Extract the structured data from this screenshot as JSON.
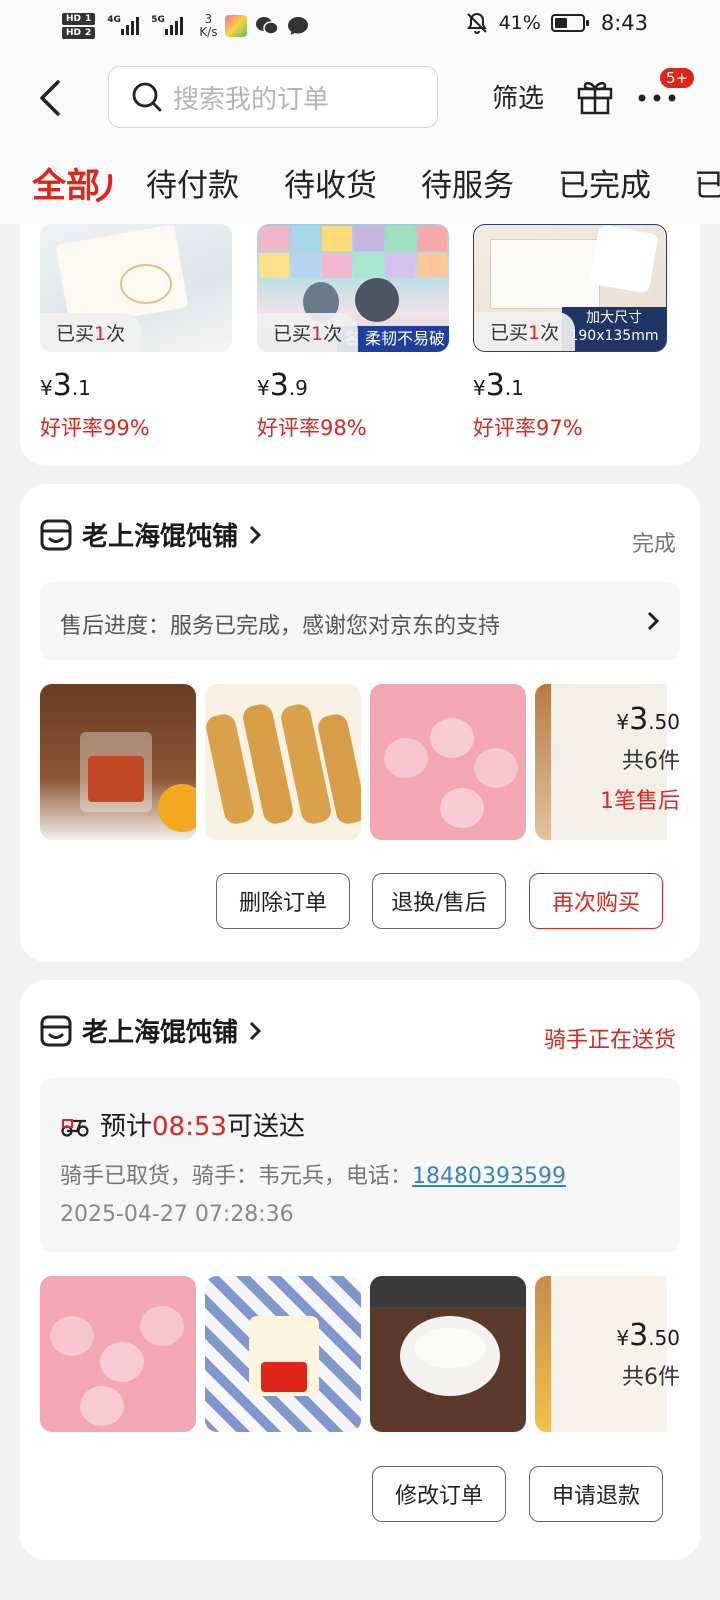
{
  "status_bar": {
    "hd1": "HD",
    "hd1_sub": "1",
    "hd2": "HD",
    "hd2_sub": "2",
    "net1": "4G",
    "net2": "5G",
    "speed_value": "3",
    "speed_unit": "K/s",
    "battery": "41%",
    "time": "8:43"
  },
  "header": {
    "search_placeholder": "搜索我的订单",
    "filter_label": "筛选",
    "notification_badge": "5+"
  },
  "tabs": [
    {
      "label": "全部",
      "active": true
    },
    {
      "label": "待付款"
    },
    {
      "label": "待收货"
    },
    {
      "label": "待服务"
    },
    {
      "label": "已完成"
    },
    {
      "label": "已"
    }
  ],
  "recommend": {
    "items": [
      {
        "bought_prefix": "已买",
        "bought_count": "1",
        "bought_suffix": "次",
        "price_symbol": "¥",
        "price_int": "3",
        "price_dec": ".1",
        "rating": "好评率99%"
      },
      {
        "bought_prefix": "已买",
        "bought_count": "1",
        "bought_suffix": "次",
        "price_symbol": "¥",
        "price_int": "3",
        "price_dec": ".9",
        "rating": "好评率98%",
        "banner": "名 柔韧不易破"
      },
      {
        "bought_prefix": "已买",
        "bought_count": "1",
        "bought_suffix": "次",
        "price_symbol": "¥",
        "price_int": "3",
        "price_dec": ".1",
        "rating": "好评率97%",
        "banner": "加大尺寸",
        "banner2": "190x135mm"
      }
    ]
  },
  "order1": {
    "shop_name": "老上海馄饨铺",
    "status": "完成",
    "progress": "售后进度：服务已完成，感谢您对京东的支持",
    "price_symbol": "¥",
    "price_int": "3",
    "price_dec": ".50",
    "count": "共6件",
    "after_sale": "1笔售后",
    "buttons": [
      "删除订单",
      "退换/售后",
      "再次购买"
    ]
  },
  "order2": {
    "shop_name": "老上海馄饨铺",
    "status": "骑手正在送货",
    "eta_prefix": "预计",
    "eta_time": "08:53",
    "eta_suffix": "可送达",
    "rider_info": "骑手已取货，骑手：韦元兵，电话：",
    "phone": "18480393599",
    "timestamp": "2025-04-27 07:28:36",
    "price_symbol": "¥",
    "price_int": "3",
    "price_dec": ".50",
    "count": "共6件",
    "buttons": [
      "修改订单",
      "申请退款"
    ]
  },
  "colors": {
    "accent": "#e1251b",
    "link": "#3b82c4",
    "background": "#f2f2f2"
  }
}
